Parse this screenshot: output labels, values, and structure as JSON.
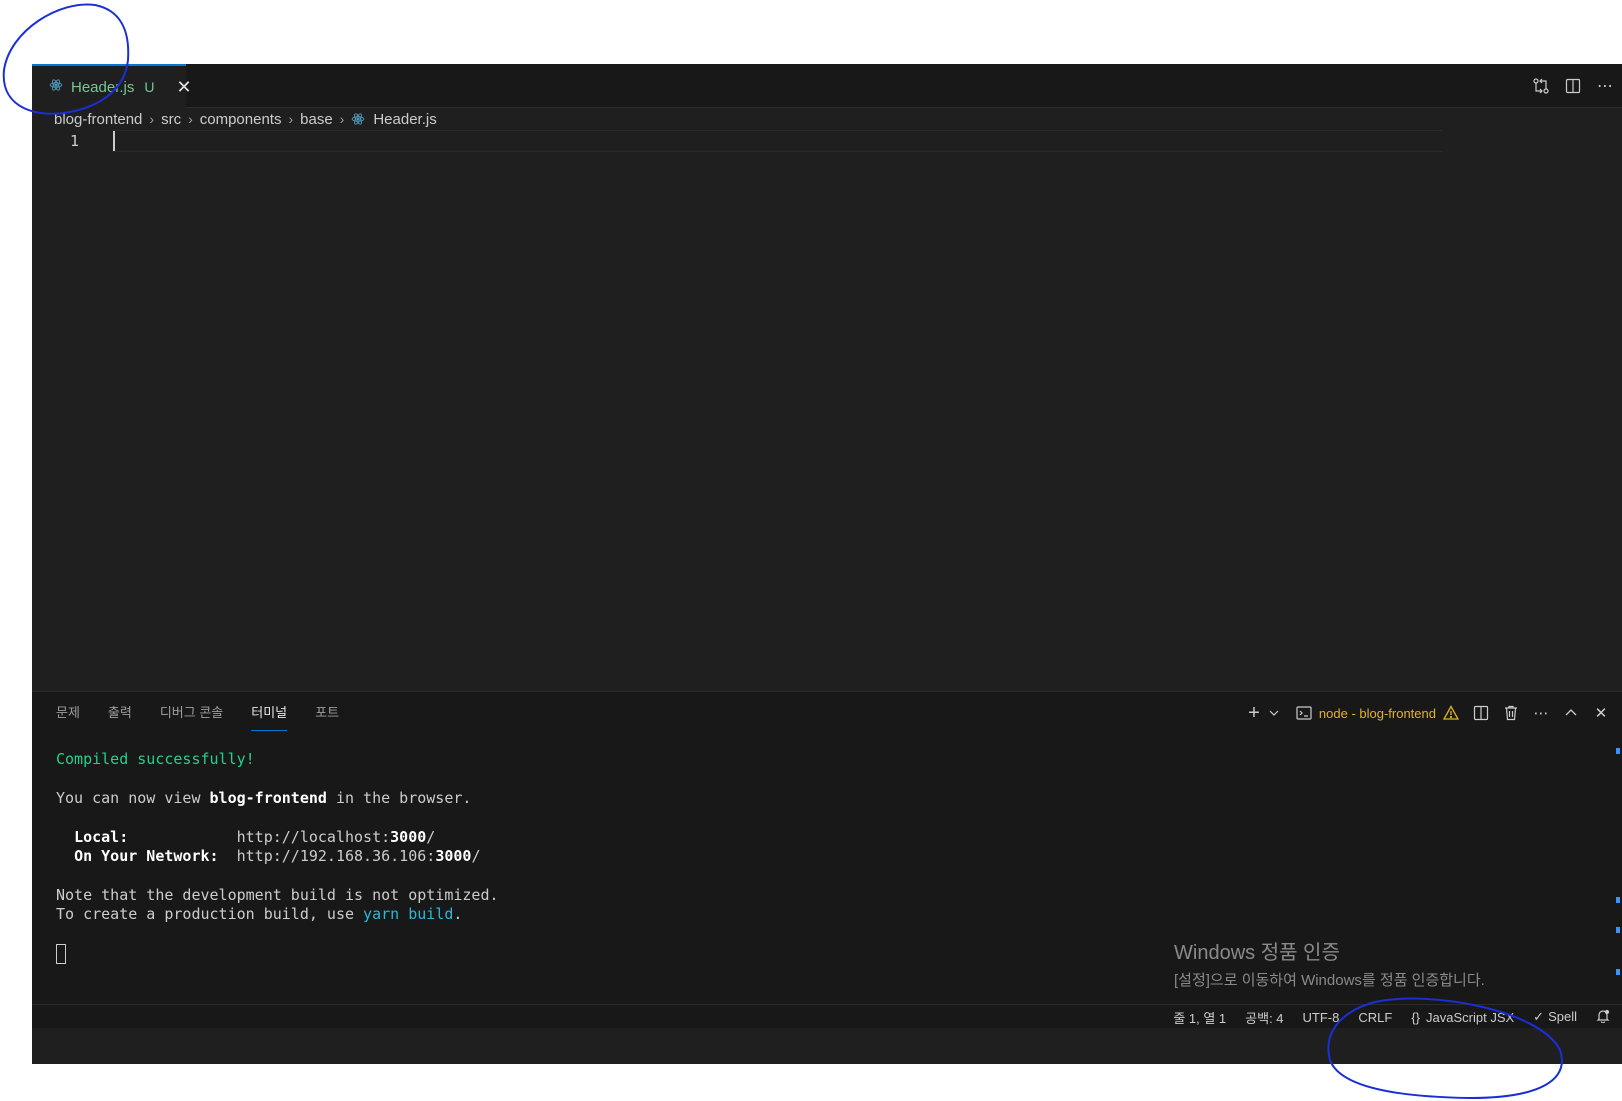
{
  "editor_tab": {
    "file_label": "Header.js",
    "status": "U"
  },
  "breadcrumb": {
    "items": [
      "blog-frontend",
      "src",
      "components",
      "base",
      "Header.js"
    ]
  },
  "editor": {
    "line_number": "1"
  },
  "panel": {
    "tabs": [
      "문제",
      "출력",
      "디버그 콘솔",
      "터미널",
      "포트"
    ],
    "active_tab": "터미널",
    "terminal_name": "node - blog-frontend"
  },
  "terminal": {
    "line1": "Compiled successfully!",
    "line2_pre": "You can now view ",
    "line2_bold": "blog-frontend",
    "line2_post": " in the browser.",
    "local_label": "Local:",
    "local_url_pre": "http://localhost:",
    "local_port": "3000",
    "local_url_post": "/",
    "network_label": "On Your Network:",
    "network_url_pre": "http://192.168.36.106:",
    "network_port": "3000",
    "network_url_post": "/",
    "note1": "Note that the development build is not optimized.",
    "note2_pre": "To create a production build, use ",
    "note2_cmd": "yarn build",
    "note2_post": "."
  },
  "watermark": {
    "title": "Windows 정품 인증",
    "subtitle": "[설정]으로 이동하여 Windows를 정품 인증합니다."
  },
  "statusbar": {
    "position": "줄 1, 열 1",
    "spaces": "공백: 4",
    "encoding": "UTF-8",
    "eol": "CRLF",
    "language": "JavaScript JSX",
    "spell": "Spell"
  },
  "colors": {
    "accent": "#0078d4",
    "git_untracked": "#73c991",
    "terminal_green": "#23d18b",
    "annotation_ink": "#1a2fd6"
  },
  "icons": [
    "react-icon",
    "close-icon",
    "compare-changes-icon",
    "split-editor-icon",
    "more-icon",
    "plus-icon",
    "chevron-down-icon",
    "terminal-icon",
    "warning-icon",
    "trash-icon",
    "chevron-up-icon",
    "bell-icon",
    "braces-icon",
    "check-icon"
  ]
}
